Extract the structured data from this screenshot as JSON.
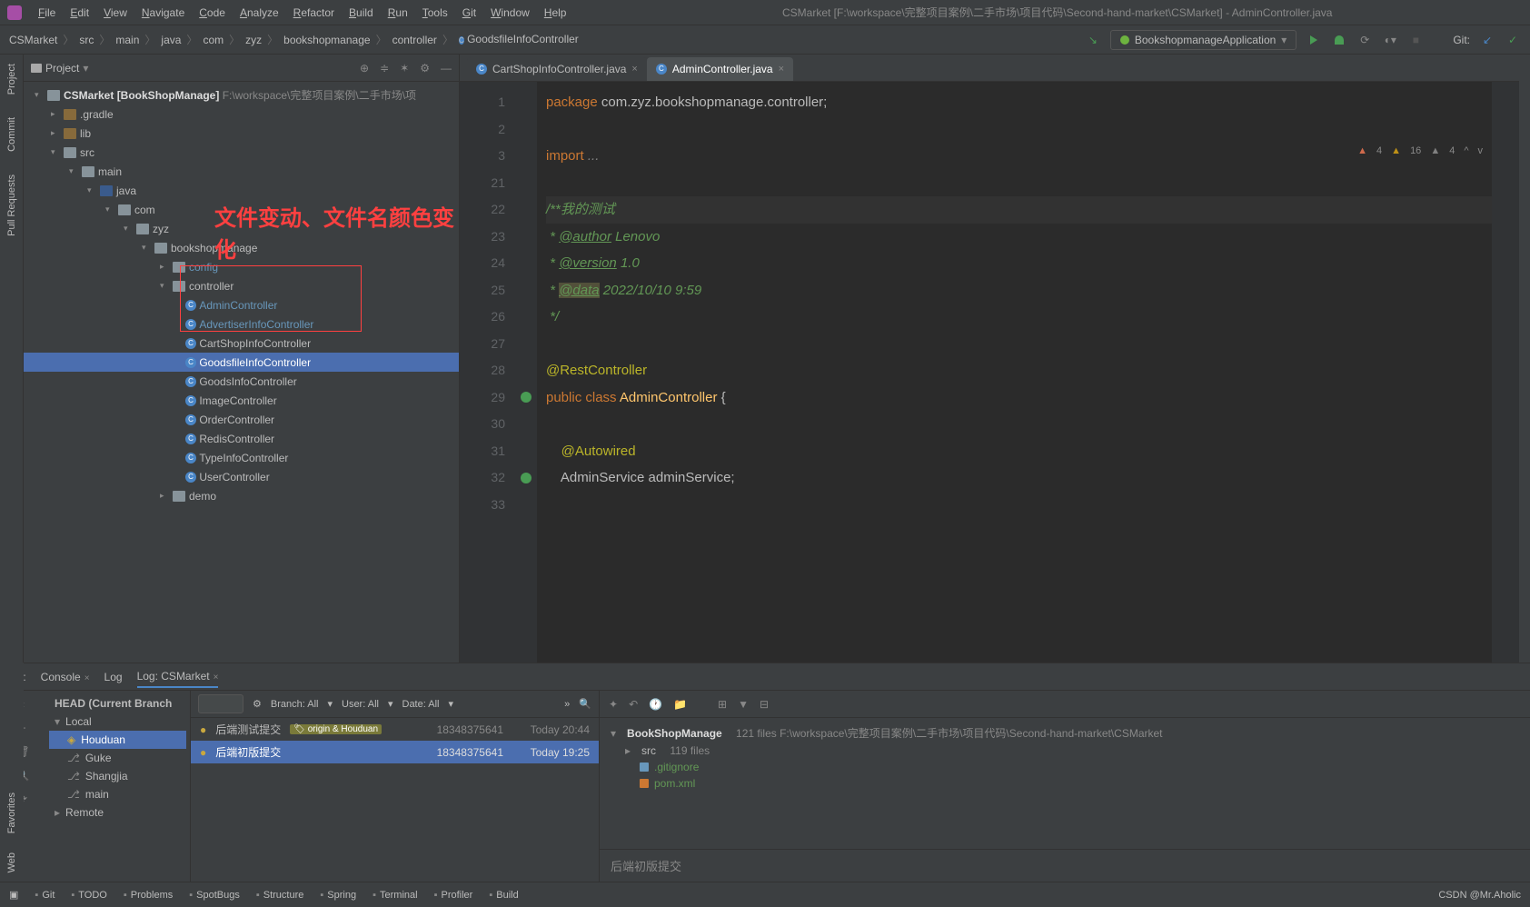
{
  "window_title": "CSMarket [F:\\workspace\\完整项目案例\\二手市场\\项目代码\\Second-hand-market\\CSMarket] - AdminController.java",
  "menubar": [
    "File",
    "Edit",
    "View",
    "Navigate",
    "Code",
    "Analyze",
    "Refactor",
    "Build",
    "Run",
    "Tools",
    "Git",
    "Window",
    "Help"
  ],
  "breadcrumb": [
    "CSMarket",
    "src",
    "main",
    "java",
    "com",
    "zyz",
    "bookshopmanage",
    "controller",
    "GoodsfileInfoController"
  ],
  "run_config": "BookshopmanageApplication",
  "git_label": "Git:",
  "left_tabs": [
    "Project",
    "Commit",
    "Pull Requests"
  ],
  "right_tabs": [
    "Favorites",
    "Web"
  ],
  "project_panel_title": "Project",
  "annotation_text": "文件变动、文件名颜色变化",
  "tree": {
    "root": "CSMarket [BookShopManage]",
    "root_path": "F:\\workspace\\完整项目案例\\二手市场\\项",
    "items": [
      ".gradle",
      "lib",
      "src",
      "main",
      "java",
      "com",
      "zyz",
      "bookshopmanage",
      "config",
      "controller"
    ],
    "controllers": [
      "AdminController",
      "AdvertiserInfoController",
      "CartShopInfoController",
      "GoodsfileInfoController",
      "GoodsInfoController",
      "ImageController",
      "OrderController",
      "RedisController",
      "TypeInfoController",
      "UserController"
    ],
    "demo": "demo"
  },
  "tabs": [
    {
      "name": "CartShopInfoController.java",
      "active": false
    },
    {
      "name": "AdminController.java",
      "active": true
    }
  ],
  "inspections": {
    "errors": "4",
    "warnings": "16",
    "weak": "4"
  },
  "gutter_lines": [
    "1",
    "2",
    "3",
    "21",
    "22",
    "23",
    "24",
    "25",
    "26",
    "27",
    "28",
    "29",
    "30",
    "31",
    "32",
    "33"
  ],
  "code_lines": [
    {
      "html": "<span class='kw'>package</span> com.zyz.bookshopmanage.controller;"
    },
    {
      "html": ""
    },
    {
      "html": "<span class='kw'>import</span> <span class='com'>...</span>"
    },
    {
      "html": ""
    },
    {
      "html": "<span class='doc'>/**我的测试</span>",
      "active": true
    },
    {
      "html": "<span class='doc'> * </span><span class='doctag'>@author</span><span class='doc'> Lenovo</span>"
    },
    {
      "html": "<span class='doc'> * </span><span class='doctag'>@version</span><span class='doc'> 1.0</span>"
    },
    {
      "html": "<span class='doc'> * </span><span class='doctag' style='background:#52503a'>@data</span><span class='doc'> 2022/10/10 9:59</span>"
    },
    {
      "html": "<span class='doc'> */</span>"
    },
    {
      "html": ""
    },
    {
      "html": "<span class='ann'>@RestController</span>"
    },
    {
      "html": "<span class='kw'>public</span> <span class='kw'>class</span> <span class='cls'>AdminController</span> {"
    },
    {
      "html": ""
    },
    {
      "html": "    <span class='ann'>@Autowired</span>"
    },
    {
      "html": "    AdminService adminService;"
    },
    {
      "html": ""
    }
  ],
  "bottom_tabs": {
    "git": "Git:",
    "console": "Console",
    "log": "Log",
    "log_cs": "Log: CSMarket"
  },
  "git_head": "HEAD (Current Branch",
  "git_local": "Local",
  "git_branches": [
    "Houduan",
    "Guke",
    "Shangjia",
    "main"
  ],
  "git_remote": "Remote",
  "git_filters": {
    "branch": "Branch: All",
    "user": "User: All",
    "date": "Date: All"
  },
  "commits": [
    {
      "msg": "后端测试提交",
      "tag": "origin & Houduan",
      "hash": "18348375641",
      "date": "Today 20:44"
    },
    {
      "msg": "后端初版提交",
      "tag": "",
      "hash": "18348375641",
      "date": "Today 19:25"
    }
  ],
  "git_repo": {
    "name": "BookShopManage",
    "info": "121 files  F:\\workspace\\完整项目案例\\二手市场\\项目代码\\Second-hand-market\\CSMarket"
  },
  "git_files": [
    {
      "name": "src",
      "info": "119 files",
      "type": "dir"
    },
    {
      "name": ".gitignore",
      "type": "file",
      "color": "#6897bb"
    },
    {
      "name": "pom.xml",
      "type": "file",
      "color": "#cc7832"
    }
  ],
  "git_commit_msg": "后端初版提交",
  "statusbar": {
    "items": [
      "Git",
      "TODO",
      "Problems",
      "SpotBugs",
      "Structure",
      "Spring",
      "Terminal",
      "Profiler",
      "Build"
    ],
    "watermark": "CSDN @Mr.Aholic"
  }
}
